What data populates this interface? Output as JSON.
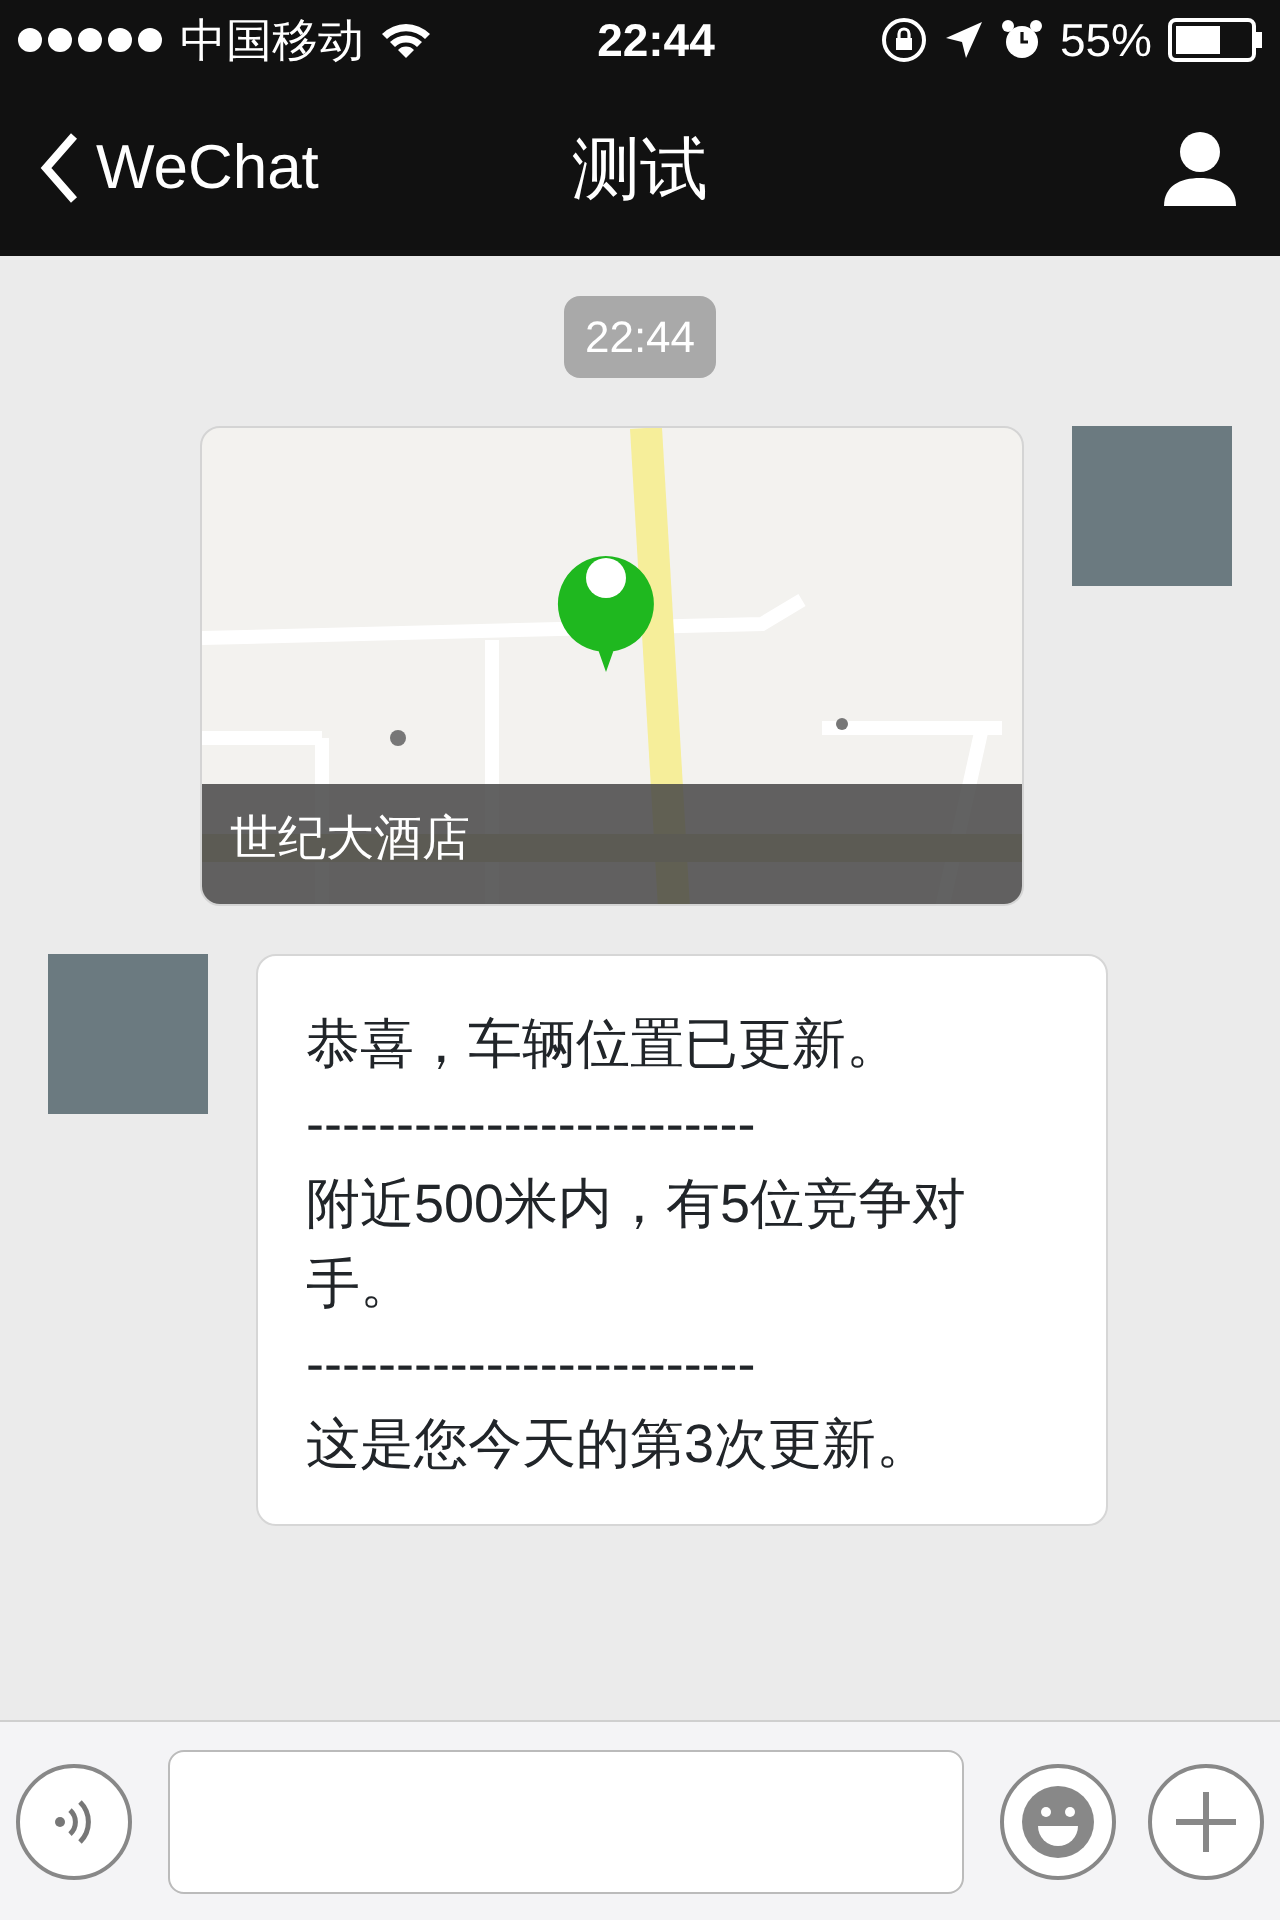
{
  "status_bar": {
    "carrier": "中国移动",
    "time": "22:44",
    "battery": "55%"
  },
  "nav": {
    "back": "WeChat",
    "title": "测试"
  },
  "messages": [
    {
      "kind": "time",
      "text": "22:44"
    },
    {
      "kind": "location",
      "outgoing": true,
      "caption": "世纪大酒店"
    },
    {
      "kind": "text",
      "outgoing": false,
      "lines": [
        "恭喜，车辆位置已更新。",
        "-------------------------",
        "附近500米内，有5位竞争对手。",
        "-------------------------",
        "这是您今天的第3次更新。"
      ]
    }
  ]
}
